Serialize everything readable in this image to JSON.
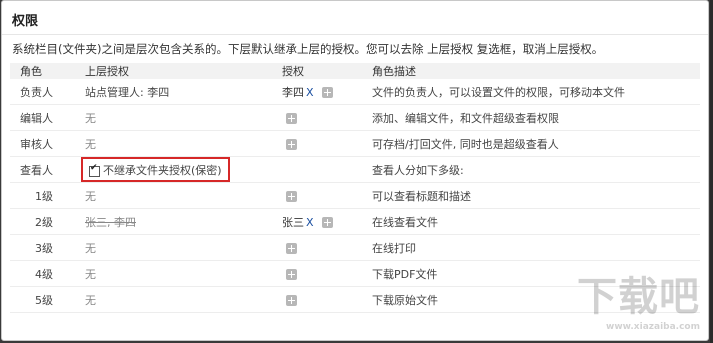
{
  "dialog": {
    "title": "权限",
    "description": "系统栏目(文件夹)之间是层次包含关系的。下层默认继承上层的授权。您可以去除 上层授权 复选框，取消上层授权。"
  },
  "table": {
    "headers": [
      "角色",
      "上层授权",
      "授权",
      "角色描述"
    ],
    "rows": [
      {
        "role": "负责人",
        "upper": "站点管理人: 李四",
        "auth_user": "李四",
        "auth_x": "X",
        "desc": "文件的负责人，可以设置文件的权限，可移动本文件"
      },
      {
        "role": "编辑人",
        "upper": "无",
        "desc": "添加、编辑文件，和文件超级查看权限"
      },
      {
        "role": "审核人",
        "upper": "无",
        "desc": "可存档/打回文件, 同时也是超级查看人"
      },
      {
        "role": "查看人",
        "checkbox_label": "不继承文件夹授权(保密)",
        "desc": "查看人分如下多级:"
      },
      {
        "role": "1级",
        "upper": "无",
        "desc": "可以查看标题和描述"
      },
      {
        "role": "2级",
        "upper_struck": "张三, 李四",
        "auth_user": "张三",
        "auth_x": "X",
        "desc": "在线查看文件"
      },
      {
        "role": "3级",
        "upper": "无",
        "desc": "在线打印"
      },
      {
        "role": "4级",
        "upper": "无",
        "desc": "下载PDF文件"
      },
      {
        "role": "5级",
        "upper": "无",
        "desc": "下载原始文件"
      }
    ]
  },
  "watermark": {
    "text": "下载吧",
    "sub": "www.xiazaiba.com"
  }
}
